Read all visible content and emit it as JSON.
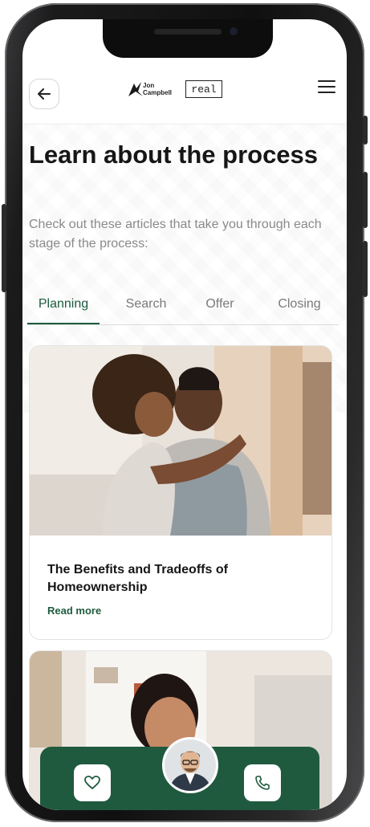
{
  "header": {
    "logo_brand_line1": "Jon",
    "logo_brand_line2": "Campbell",
    "logo_partner": "real"
  },
  "page": {
    "title": "Learn about the process",
    "subtitle": "Check out these articles that take you through each stage of the process:"
  },
  "tabs": [
    {
      "label": "Planning",
      "active": true
    },
    {
      "label": "Search",
      "active": false
    },
    {
      "label": "Offer",
      "active": false
    },
    {
      "label": "Closing",
      "active": false
    }
  ],
  "articles": [
    {
      "title": "The Benefits and Tradeoffs of Homeownership",
      "link_label": "Read more"
    }
  ],
  "icons": {
    "back": "arrow-left-icon",
    "menu": "hamburger-menu-icon",
    "favorite": "heart-icon",
    "call": "phone-icon"
  },
  "colors": {
    "accent": "#1d5b3f",
    "bottom_bar": "#1f5a3f",
    "text_primary": "#161616",
    "text_secondary": "#8a8a8a"
  }
}
